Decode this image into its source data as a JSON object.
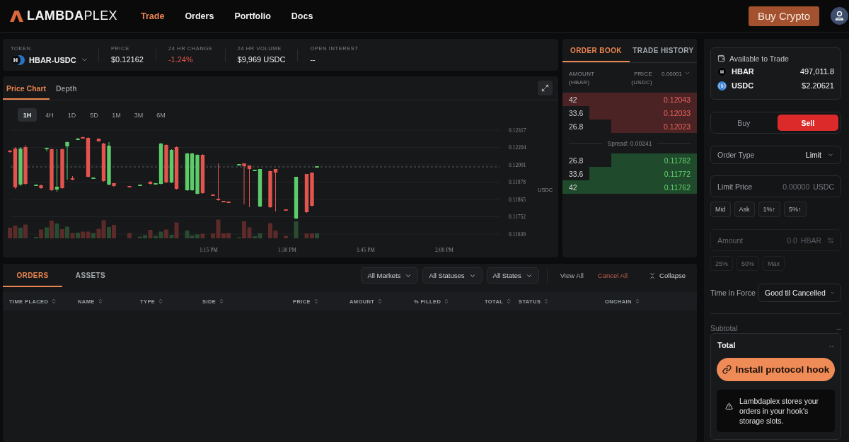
{
  "header": {
    "logo": "**LAMBDA**PLEX",
    "nav": [
      {
        "label": "Trade",
        "selected": true
      },
      {
        "label": "Orders",
        "selected": false
      },
      {
        "label": "Portfolio",
        "selected": false
      },
      {
        "label": "Docs",
        "selected": false
      }
    ],
    "buy_button": "Buy Crypto"
  },
  "market_bar": {
    "token": {
      "label": "TOKEN",
      "symbol": "HBAR-USDC"
    },
    "stats": [
      {
        "label": "PRICE",
        "value": "$0.12162",
        "negative": false
      },
      {
        "label": "24 HR CHANGE",
        "value": "-1.24%",
        "negative": true
      },
      {
        "label": "24 HR VOLUME",
        "value": "$9,969 USDC",
        "negative": false
      },
      {
        "label": "OPEN INTEREST",
        "value": "--",
        "negative": false
      }
    ]
  },
  "chart_panel": {
    "tabs": [
      {
        "label": "Price Chart",
        "selected": true
      },
      {
        "label": "Depth",
        "selected": false
      }
    ],
    "timeframes": [
      {
        "label": "1H",
        "selected": true
      },
      {
        "label": "4H",
        "selected": false
      },
      {
        "label": "1D",
        "selected": false
      },
      {
        "label": "5D",
        "selected": false
      },
      {
        "label": "1M",
        "selected": false
      },
      {
        "label": "3M",
        "selected": false
      },
      {
        "label": "6M",
        "selected": false
      }
    ],
    "y_ticks": [
      "0.12317",
      "0.12204",
      "0.12091",
      "0.11978",
      "0.11865",
      "0.11752",
      "0.11639"
    ],
    "y_unit": "USDC",
    "x_ticks": [
      "1:15 PM",
      "1:30 PM",
      "1:45 PM",
      "2:00 PM"
    ]
  },
  "order_book": {
    "tabs": [
      {
        "label": "ORDER BOOK",
        "selected": true
      },
      {
        "label": "TRADE HISTORY",
        "selected": false
      }
    ],
    "amount_header": "AMOUNT",
    "amount_unit": "(HBAR)",
    "price_header": "PRICE",
    "price_unit": "(USDC)",
    "precision": "0.00001",
    "asks": [
      {
        "amount": "42",
        "price": "0.12043"
      },
      {
        "amount": "33.6",
        "price": "0.12033"
      },
      {
        "amount": "26.8",
        "price": "0.12023"
      }
    ],
    "spread": "Spread: 0.00241",
    "bids": [
      {
        "amount": "26.8",
        "price": "0.11782"
      },
      {
        "amount": "33.6",
        "price": "0.11772"
      },
      {
        "amount": "42",
        "price": "0.11762"
      }
    ]
  },
  "trade_panel": {
    "available": {
      "title": "Available to Trade",
      "assets": [
        {
          "symbol": "HBAR",
          "amount": "497,011.8",
          "kind": "hbar"
        },
        {
          "symbol": "USDC",
          "amount": "$2.20621",
          "kind": "usdc"
        }
      ]
    },
    "sides": [
      {
        "label": "Buy",
        "kind": "buy",
        "selected": false
      },
      {
        "label": "Sell",
        "kind": "sell",
        "selected": true
      }
    ],
    "order_type": {
      "label": "Order Type",
      "value": "Limit"
    },
    "limit_price": {
      "label": "Limit Price",
      "placeholder": "0.00000",
      "unit": "USDC"
    },
    "price_presets": [
      "Mid",
      "Ask",
      "1%↑",
      "5%↑"
    ],
    "amount": {
      "label": "Amount",
      "placeholder": "0.0",
      "unit": "HBAR",
      "disabled": true
    },
    "amount_presets": [
      {
        "label": "25%",
        "disabled": true
      },
      {
        "label": "50%",
        "disabled": true
      },
      {
        "label": "Max",
        "disabled": true
      }
    ],
    "time_in_force": {
      "label": "Time in Force",
      "value": "Good til Cancelled"
    },
    "subtotal": {
      "label": "Subtotal",
      "value": "--"
    },
    "total": {
      "label": "Total",
      "value": "--"
    },
    "install_button": "Install protocol hook",
    "notice": "Lambdaplex stores your orders in your hook's storage slots."
  },
  "orders_panel": {
    "tabs": [
      {
        "label": "ORDERS",
        "selected": true
      },
      {
        "label": "ASSETS",
        "selected": false
      }
    ],
    "filters": [
      "All Markets",
      "All Statuses",
      "All States"
    ],
    "actions": [
      {
        "label": "View All",
        "kind": "neutral"
      },
      {
        "label": "Cancel All",
        "kind": "danger"
      }
    ],
    "collapse": "Collapse",
    "columns": [
      "TIME PLACED",
      "NAME",
      "TYPE",
      "SIDE",
      "PRICE",
      "AMOUNT",
      "% FILLED",
      "TOTAL",
      "STATUS",
      "ONCHAIN"
    ]
  }
}
